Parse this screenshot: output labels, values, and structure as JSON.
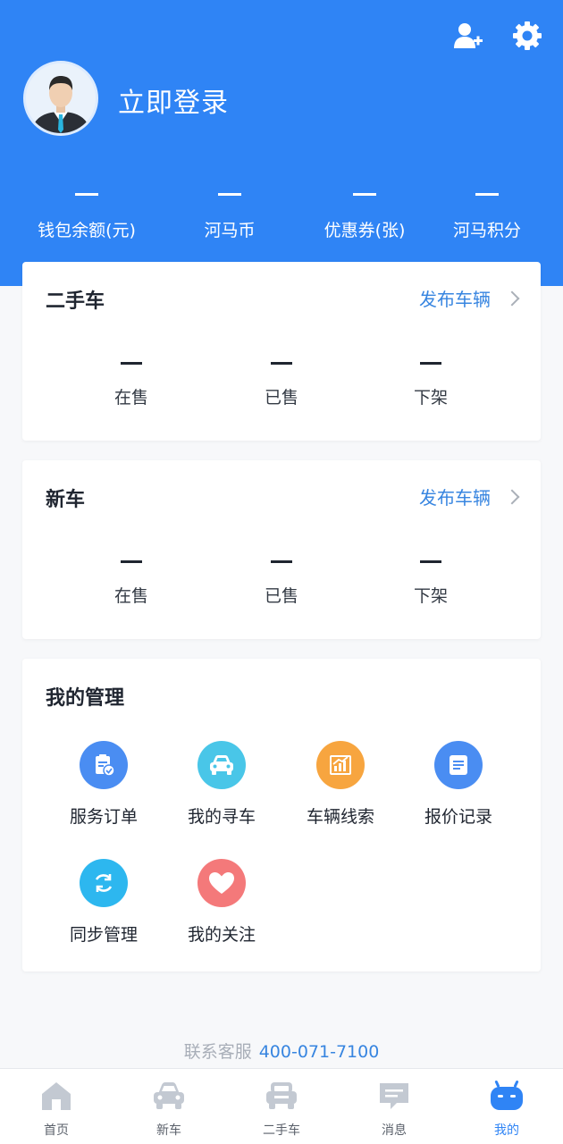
{
  "header": {
    "login_label": "立即登录",
    "stats": [
      {
        "value": "—",
        "label": "钱包余额(元)"
      },
      {
        "value": "—",
        "label": "河马币"
      },
      {
        "value": "—",
        "label": "优惠券(张)"
      },
      {
        "value": "—",
        "label": "河马积分"
      }
    ],
    "icons": [
      "add-user-icon",
      "settings-gear-icon"
    ]
  },
  "used_car": {
    "title": "二手车",
    "link": "发布车辆",
    "stats": [
      {
        "value": "—",
        "label": "在售"
      },
      {
        "value": "—",
        "label": "已售"
      },
      {
        "value": "—",
        "label": "下架"
      }
    ]
  },
  "new_car": {
    "title": "新车",
    "link": "发布车辆",
    "stats": [
      {
        "value": "—",
        "label": "在售"
      },
      {
        "value": "—",
        "label": "已售"
      },
      {
        "value": "—",
        "label": "下架"
      }
    ]
  },
  "management": {
    "title": "我的管理",
    "items": [
      {
        "label": "服务订单",
        "icon": "clipboard-check-icon",
        "color": "#4a8df2"
      },
      {
        "label": "我的寻车",
        "icon": "car-front-icon",
        "color": "#49c6e8"
      },
      {
        "label": "车辆线索",
        "icon": "bar-chart-icon",
        "color": "#f7a53f"
      },
      {
        "label": "报价记录",
        "icon": "note-list-icon",
        "color": "#4a8df2"
      },
      {
        "label": "同步管理",
        "icon": "sync-icon",
        "color": "#2db7ef"
      },
      {
        "label": "我的关注",
        "icon": "heart-icon",
        "color": "#f4797a"
      }
    ]
  },
  "service": {
    "label": "联系客服",
    "phone": "400-071-7100"
  },
  "tabs": [
    {
      "label": "首页",
      "icon": "home-icon"
    },
    {
      "label": "新车",
      "icon": "car-icon"
    },
    {
      "label": "二手车",
      "icon": "used-car-icon"
    },
    {
      "label": "消息",
      "icon": "message-icon"
    },
    {
      "label": "我的",
      "icon": "profile-robot-icon",
      "active": true
    }
  ],
  "colors": {
    "primary": "#2f84f5",
    "link": "#3785e0",
    "tab_inactive": "#c3c9d2"
  }
}
